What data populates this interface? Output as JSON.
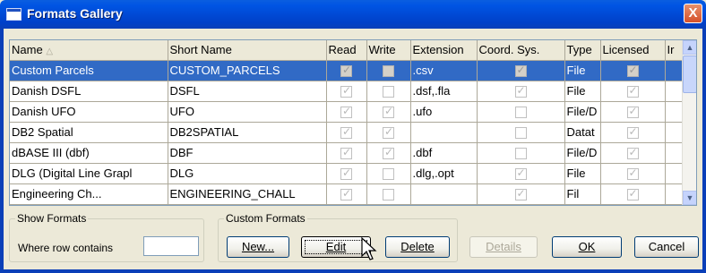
{
  "window": {
    "title": "Formats Gallery",
    "close_glyph": "X"
  },
  "table": {
    "columns": [
      "Name",
      "Short Name",
      "Read",
      "Write",
      "Extension",
      "Coord. Sys.",
      "Type",
      "Licensed",
      "Ir"
    ],
    "rows": [
      {
        "name": "Custom Parcels",
        "short": "CUSTOM_PARCELS",
        "read": true,
        "write": false,
        "ext": ".csv",
        "coord": true,
        "type": "File",
        "licensed": true,
        "selected": true
      },
      {
        "name": "Danish DSFL",
        "short": "DSFL",
        "read": true,
        "write": false,
        "ext": ".dsf,.fla",
        "coord": true,
        "type": "File",
        "licensed": true,
        "selected": false
      },
      {
        "name": "Danish UFO",
        "short": "UFO",
        "read": true,
        "write": true,
        "ext": ".ufo",
        "coord": false,
        "type": "File/D",
        "licensed": true,
        "selected": false
      },
      {
        "name": "DB2 Spatial",
        "short": "DB2SPATIAL",
        "read": true,
        "write": true,
        "ext": "",
        "coord": false,
        "type": "Datat",
        "licensed": true,
        "selected": false
      },
      {
        "name": "dBASE III (dbf)",
        "short": "DBF",
        "read": true,
        "write": true,
        "ext": ".dbf",
        "coord": false,
        "type": "File/D",
        "licensed": true,
        "selected": false
      },
      {
        "name": "DLG (Digital Line Grapl",
        "short": "DLG",
        "read": true,
        "write": false,
        "ext": ".dlg,.opt",
        "coord": true,
        "type": "File",
        "licensed": true,
        "selected": false
      },
      {
        "name": "Engineering Ch...",
        "short": "ENGINEERING_CHALL",
        "read": true,
        "write": false,
        "ext": "",
        "coord": true,
        "type": "Fil",
        "licensed": true,
        "selected": false
      }
    ]
  },
  "show_formats": {
    "label": "Show Formats",
    "where_label": "Where row contains",
    "value": ""
  },
  "custom_formats": {
    "label": "Custom Formats",
    "new_label": "New...",
    "edit_label": "Edit",
    "delete_label": "Delete"
  },
  "buttons": {
    "details": "Details",
    "ok": "OK",
    "cancel": "Cancel"
  },
  "scroll": {
    "up": "▲",
    "down": "▼"
  }
}
